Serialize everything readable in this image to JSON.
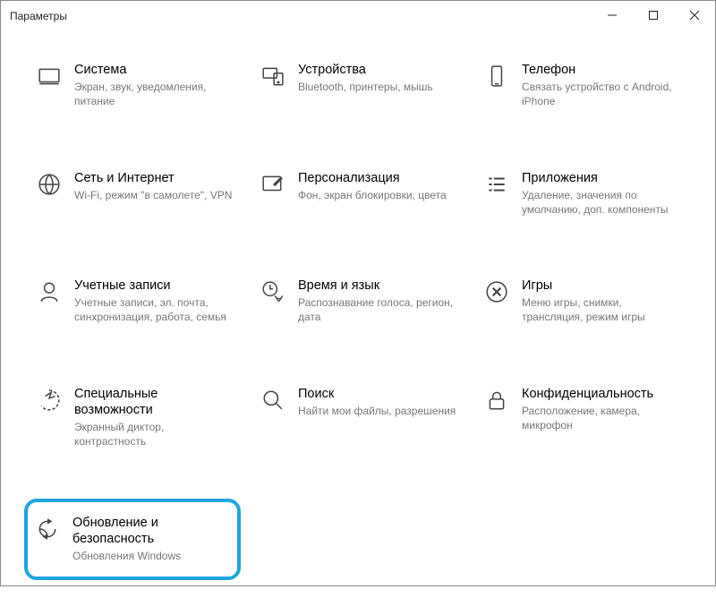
{
  "window": {
    "title": "Параметры"
  },
  "tiles": [
    {
      "title": "Система",
      "desc": "Экран, звук, уведомления, питание"
    },
    {
      "title": "Устройства",
      "desc": "Bluetooth, принтеры, мышь"
    },
    {
      "title": "Телефон",
      "desc": "Связать устройство с Android, iPhone"
    },
    {
      "title": "Сеть и Интернет",
      "desc": "Wi-Fi, режим \"в самолете\", VPN"
    },
    {
      "title": "Персонализация",
      "desc": "Фон, экран блокировки, цвета"
    },
    {
      "title": "Приложения",
      "desc": "Удаление, значения по умолчанию, доп. компоненты"
    },
    {
      "title": "Учетные записи",
      "desc": "Учетные записи, эл. почта, синхронизация, работа, семья"
    },
    {
      "title": "Время и язык",
      "desc": "Распознавание голоса, регион, дата"
    },
    {
      "title": "Игры",
      "desc": "Меню игры, снимки, трансляция, режим игры"
    },
    {
      "title": "Специальные возможности",
      "desc": "Экранный диктор, контрастность"
    },
    {
      "title": "Поиск",
      "desc": "Найти мои файлы, разрешения"
    },
    {
      "title": "Конфиденциальность",
      "desc": "Расположение, камера, микрофон"
    },
    {
      "title": "Обновление и безопасность",
      "desc": "Обновления Windows"
    }
  ]
}
